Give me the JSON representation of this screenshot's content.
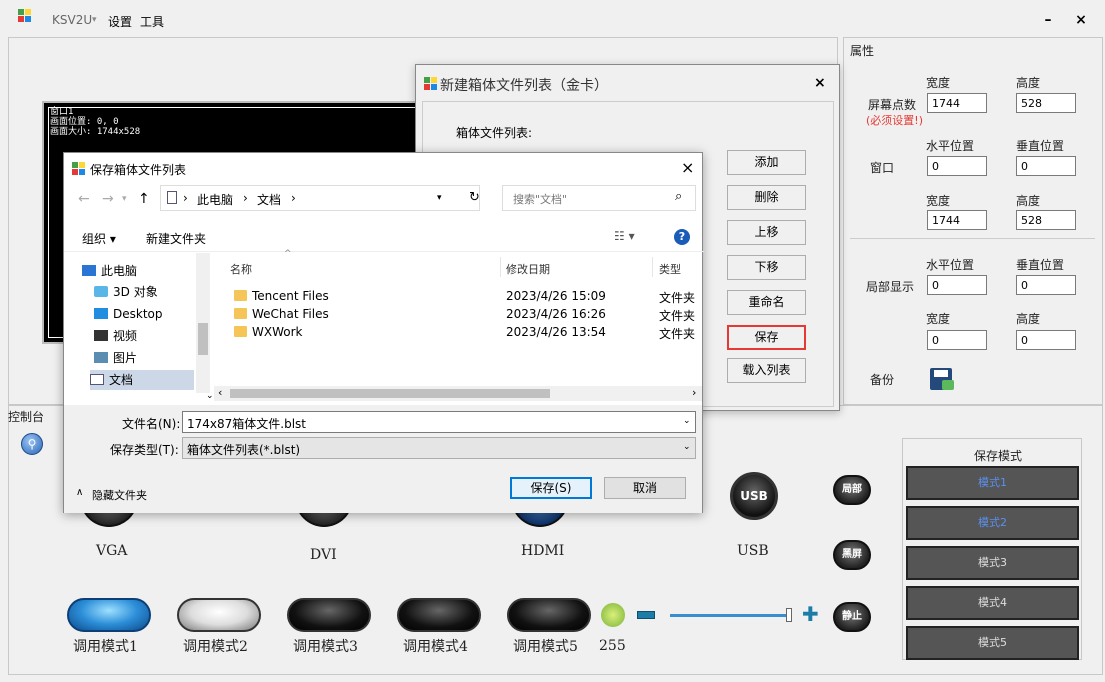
{
  "app": {
    "title": "KSV2U",
    "menu": [
      "设置",
      "工具"
    ],
    "minimize": "–",
    "close": "×"
  },
  "preview": {
    "line1": "窗口1",
    "line2": "画面位置: 0, 0",
    "line3": "画面大小: 1744x528"
  },
  "properties": {
    "header": "属性",
    "screen_pixels_label": "屏幕点数",
    "required_note": "(必须设置!)",
    "width_label": "宽度",
    "height_label": "高度",
    "screen_width": "1744",
    "screen_height": "528",
    "window_label": "窗口",
    "h_pos_label": "水平位置",
    "v_pos_label": "垂直位置",
    "window_x": "0",
    "window_y": "0",
    "window_width": "1744",
    "window_height": "528",
    "local_label": "局部显示",
    "local_x": "0",
    "local_y": "0",
    "local_width": "0",
    "local_height": "0",
    "backup_label": "备份",
    "save_mode_title": "保存模式"
  },
  "console": {
    "label": "控制台",
    "inputs": [
      "VGA",
      "DVI",
      "HDMI",
      "USB"
    ],
    "usb_badge": "USB",
    "round_buttons": [
      "局部",
      "黑屏",
      "静止"
    ],
    "call_modes": [
      "调用模式1",
      "调用模式2",
      "调用模式3",
      "调用模式4",
      "调用模式5"
    ],
    "brightness_value": "255",
    "save_modes": [
      "模式1",
      "模式2",
      "模式3",
      "模式4",
      "模式5"
    ],
    "colors": {
      "active_mode": "#5a8ff0",
      "highlight": "#e53935"
    }
  },
  "cabinet_dialog": {
    "title": "新建箱体文件列表（金卡）",
    "list_label": "箱体文件列表:",
    "close": "×",
    "buttons": [
      "添加",
      "删除",
      "上移",
      "下移",
      "重命名",
      "保存",
      "载入列表"
    ]
  },
  "save_dialog": {
    "title": "保存箱体文件列表",
    "close": "×",
    "breadcrumb": [
      "此电脑",
      "文档"
    ],
    "search_placeholder": "搜索\"文档\"",
    "organize": "组织 ▾",
    "new_folder": "新建文件夹",
    "columns": {
      "name": "名称",
      "date": "修改日期",
      "type": "类型"
    },
    "nav": [
      "此电脑",
      "3D 对象",
      "Desktop",
      "视频",
      "图片",
      "文档"
    ],
    "files": [
      {
        "name": "Tencent Files",
        "date": "2023/4/26 15:09",
        "type": "文件夹"
      },
      {
        "name": "WeChat Files",
        "date": "2023/4/26 16:26",
        "type": "文件夹"
      },
      {
        "name": "WXWork",
        "date": "2023/4/26 13:54",
        "type": "文件夹"
      }
    ],
    "filename_label": "文件名(N):",
    "filename": "174x87箱体文件.blst",
    "filetype_label": "保存类型(T):",
    "filetype": "箱体文件列表(*.blst)",
    "hide_folders": "隐藏文件夹",
    "save": "保存(S)",
    "cancel": "取消"
  }
}
